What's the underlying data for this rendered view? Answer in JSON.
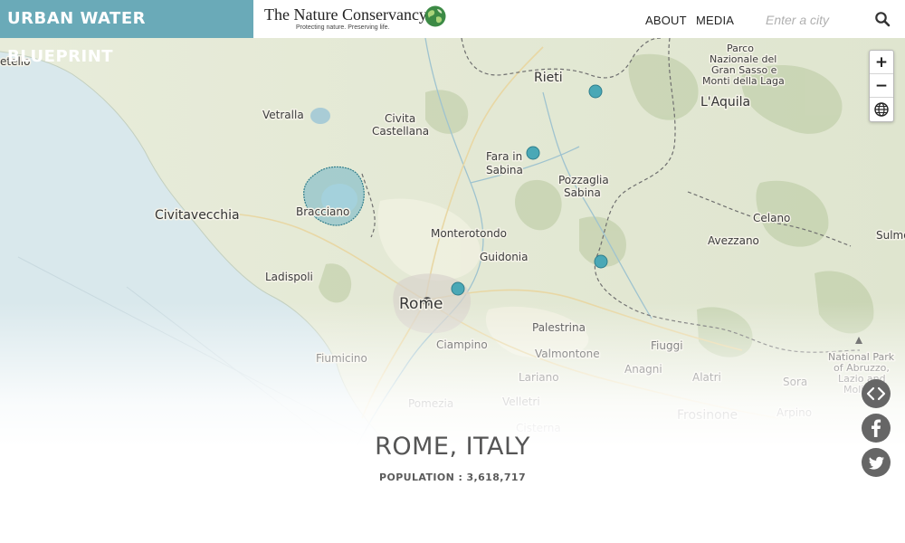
{
  "header": {
    "brand": "URBAN WATER BLUEPRINT",
    "partner_name": "The Nature Conservancy",
    "partner_tagline": "Protecting nature. Preserving life.",
    "nav": [
      "ABOUT",
      "MEDIA"
    ],
    "search_placeholder": "Enter a city",
    "colors": {
      "brand_bg": "#6aaab8",
      "brand_text": "#ffffff"
    }
  },
  "map": {
    "zoom_buttons": [
      "+",
      "−"
    ],
    "labels": {
      "tello": "etello",
      "vetralla": "Vetralla",
      "civita_1": "Civita",
      "civita_2": "Castellana",
      "rieti": "Rieti",
      "parco_1": "Parco",
      "parco_2": "Nazionale del",
      "parco_3": "Gran Sasso e",
      "parco_4": "Monti della Laga",
      "laquila": "L'Aquila",
      "fara_1": "Fara in",
      "fara_2": "Sabina",
      "pozzaglia_1": "Pozzaglia",
      "pozzaglia_2": "Sabina",
      "civitavecchia": "Civitavecchia",
      "bracciano": "Bracciano",
      "celano": "Celano",
      "monterotondo": "Monterotondo",
      "avezzano": "Avezzano",
      "sulmo": "Sulmo",
      "guidonia": "Guidonia",
      "ladispoli": "Ladispoli",
      "rome": "Rome",
      "palestrina": "Palestrina",
      "ciampino": "Ciampino",
      "fiuggi": "Fiuggi",
      "valmontone": "Valmontone",
      "fiumicino": "Fiumicino",
      "anagni": "Anagni",
      "alatri": "Alatri",
      "lariano": "Lariano",
      "sora": "Sora",
      "abruzzo_1": "National Park",
      "abruzzo_2": "of Abruzzo,",
      "abruzzo_3": "Lazio and",
      "abruzzo_4": "Molis",
      "pomezia": "Pomezia",
      "velletri": "Velletri",
      "arpino": "Arpino",
      "frosinone": "Frosinone",
      "cisterna": "Cisterna"
    },
    "colors": {
      "water": "#d9e8ec",
      "land": "#eceee0",
      "source_marker": "#4aa8b6",
      "city_marker": "#555555"
    }
  },
  "city": {
    "title": "ROME, ITALY",
    "population": "POPULATION : 3,618,717"
  },
  "share": {
    "icons": [
      "embed-icon",
      "facebook-icon",
      "twitter-icon"
    ],
    "color": "#666666"
  }
}
